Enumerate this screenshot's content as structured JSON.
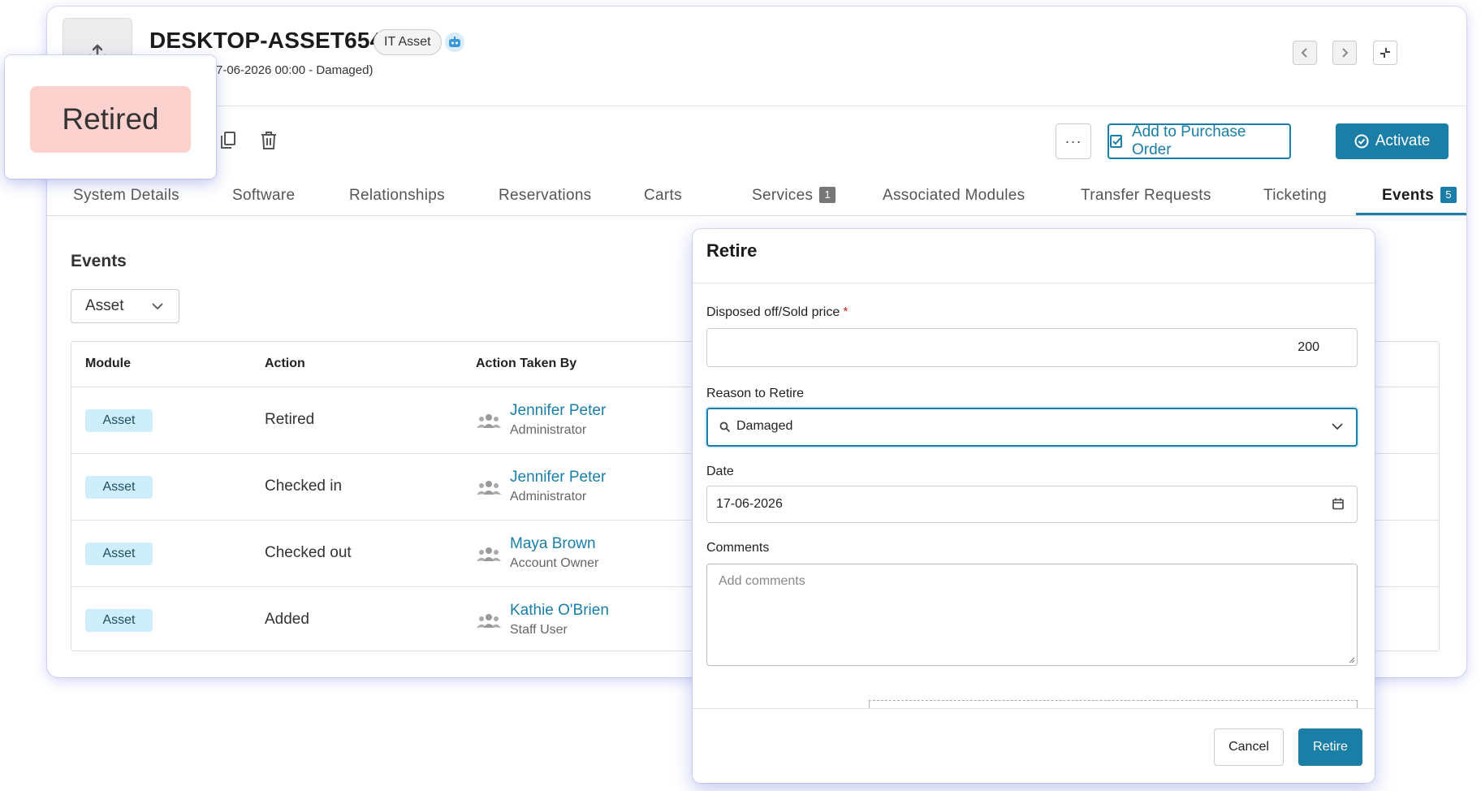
{
  "header": {
    "asset_name": "DESKTOP-ASSET654",
    "asset_type": "IT Asset",
    "subtitle": "7-06-2026 00:00 - Damaged)",
    "status_badge": "Retired"
  },
  "toolbar": {
    "more_label": "···",
    "purchase_order_label": "Add to Purchase Order",
    "activate_label": "Activate"
  },
  "tabs": [
    {
      "label": "System Details"
    },
    {
      "label": "Software"
    },
    {
      "label": "Relationships"
    },
    {
      "label": "Reservations"
    },
    {
      "label": "Carts"
    },
    {
      "label": "Services",
      "badge": "1"
    },
    {
      "label": "Associated Modules"
    },
    {
      "label": "Transfer Requests"
    },
    {
      "label": "Ticketing"
    },
    {
      "label": "Events",
      "badge": "5",
      "active": true
    }
  ],
  "events": {
    "title": "Events",
    "filter_value": "Asset",
    "columns": {
      "module": "Module",
      "action": "Action",
      "taken_by": "Action Taken By"
    },
    "rows": [
      {
        "module": "Asset",
        "action": "Retired",
        "user": "Jennifer Peter",
        "role": "Administrator"
      },
      {
        "module": "Asset",
        "action": "Checked in",
        "user": "Jennifer Peter",
        "role": "Administrator"
      },
      {
        "module": "Asset",
        "action": "Checked out",
        "user": "Maya Brown",
        "role": "Account Owner"
      },
      {
        "module": "Asset",
        "action": "Added",
        "user": "Kathie O'Brien",
        "role": "Staff User"
      }
    ]
  },
  "modal": {
    "title": "Retire",
    "price_label": "Disposed off/Sold price",
    "price_required": "*",
    "price_value": "200",
    "reason_label": "Reason to Retire",
    "reason_value": "Damaged",
    "date_label": "Date",
    "date_value": "17-06-2026",
    "comments_label": "Comments",
    "comments_placeholder": "Add comments",
    "cancel_label": "Cancel",
    "retire_label": "Retire"
  },
  "colors": {
    "accent": "#1a7ea6",
    "retired_chip": "#fcd1ce",
    "module_pill": "#cdeefa",
    "required": "#d0262b"
  }
}
